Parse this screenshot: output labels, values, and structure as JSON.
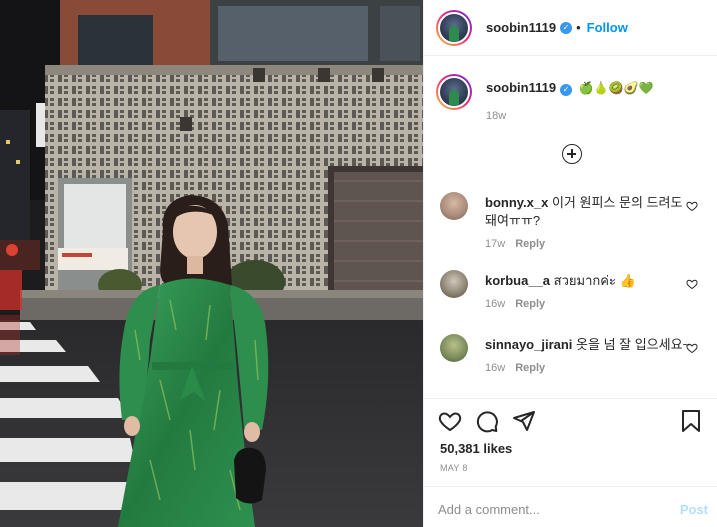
{
  "header": {
    "username": "soobin1119",
    "separator": "•",
    "follow_label": "Follow"
  },
  "caption": {
    "username": "soobin1119",
    "text": "🍏🍐🥝🥑💚",
    "time": "18w"
  },
  "comments": [
    {
      "username": "bonny.x_x",
      "text": "이거 원피스 문의 드려도 돼여ㅠㅠ?",
      "time": "17w",
      "reply": "Reply",
      "avatar_color": "#a88a7a"
    },
    {
      "username": "korbua__a",
      "text": "สวยมากค่ะ 👍",
      "time": "16w",
      "reply": "Reply",
      "avatar_color": "#8a8070"
    },
    {
      "username": "sinnayo_jirani",
      "text": "옷을 넘 잘 입으세요~",
      "time": "16w",
      "reply": "Reply",
      "avatar_color": "#7a8a5a"
    }
  ],
  "post": {
    "likes": "50,381 likes",
    "date": "MAY 8",
    "comment_placeholder": "Add a comment...",
    "post_label": "Post"
  },
  "colors": {
    "accent": "#0095f6",
    "verified": "#3897f0",
    "dress": "#2f8a4e"
  },
  "icons": [
    "verified-icon",
    "add-icon",
    "heart-icon",
    "comment-icon",
    "share-icon",
    "bookmark-icon"
  ]
}
